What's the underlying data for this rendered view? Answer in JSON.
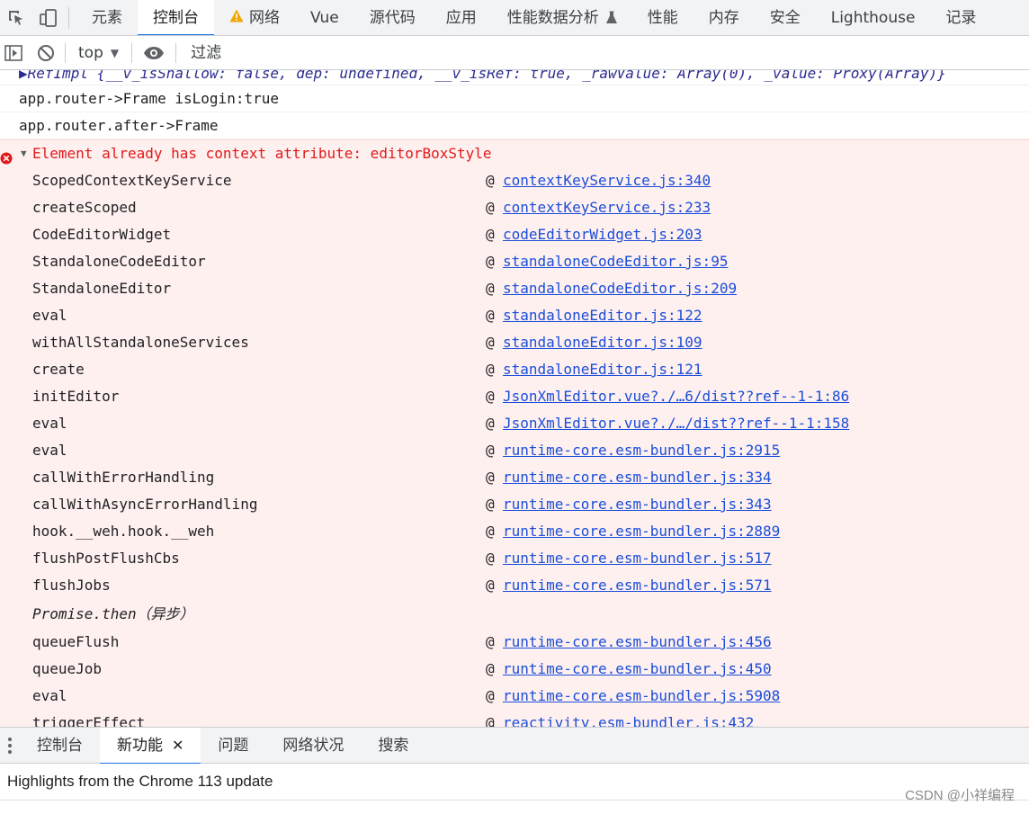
{
  "tabs": [
    {
      "label": "元素"
    },
    {
      "label": "控制台",
      "active": true
    },
    {
      "label": "网络",
      "warning": true
    },
    {
      "label": "Vue"
    },
    {
      "label": "源代码"
    },
    {
      "label": "应用"
    },
    {
      "label": "性能数据分析",
      "icon": "flask-icon"
    },
    {
      "label": "性能"
    },
    {
      "label": "内存"
    },
    {
      "label": "安全"
    },
    {
      "label": "Lighthouse"
    },
    {
      "label": "记录"
    }
  ],
  "toolbar": {
    "context": "top",
    "filter_placeholder": "过滤"
  },
  "console": {
    "cut_line": "▶RefImpl {__v_isShallow: false, dep: undefined, __v_isRef: true, _rawValue: Array(0), _value: Proxy(Array)}",
    "logs": [
      "app.router->Frame isLogin:true",
      "app.router.after->Frame"
    ],
    "error": {
      "message": "Element already has context attribute: editorBoxStyle",
      "at_symbol": "@",
      "frames": [
        {
          "fn": "ScopedContextKeyService",
          "src": "contextKeyService.js:340"
        },
        {
          "fn": "createScoped",
          "src": "contextKeyService.js:233"
        },
        {
          "fn": "CodeEditorWidget",
          "src": "codeEditorWidget.js:203"
        },
        {
          "fn": "StandaloneCodeEditor",
          "src": "standaloneCodeEditor.js:95"
        },
        {
          "fn": "StandaloneEditor",
          "src": "standaloneCodeEditor.js:209"
        },
        {
          "fn": "eval",
          "src": "standaloneEditor.js:122"
        },
        {
          "fn": "withAllStandaloneServices",
          "src": "standaloneEditor.js:109"
        },
        {
          "fn": "create",
          "src": "standaloneEditor.js:121"
        },
        {
          "fn": "initEditor",
          "src": "JsonXmlEditor.vue?./…6/dist??ref--1-1:86"
        },
        {
          "fn": "eval",
          "src": "JsonXmlEditor.vue?./…/dist??ref--1-1:158"
        },
        {
          "fn": "eval",
          "src": "runtime-core.esm-bundler.js:2915"
        },
        {
          "fn": "callWithErrorHandling",
          "src": "runtime-core.esm-bundler.js:334"
        },
        {
          "fn": "callWithAsyncErrorHandling",
          "src": "runtime-core.esm-bundler.js:343"
        },
        {
          "fn": "hook.__weh.hook.__weh",
          "src": "runtime-core.esm-bundler.js:2889"
        },
        {
          "fn": "flushPostFlushCbs",
          "src": "runtime-core.esm-bundler.js:517"
        },
        {
          "fn": "flushJobs",
          "src": "runtime-core.esm-bundler.js:571"
        },
        {
          "fn": "Promise.then（异步）",
          "src": null,
          "async": true
        },
        {
          "fn": "queueFlush",
          "src": "runtime-core.esm-bundler.js:456"
        },
        {
          "fn": "queueJob",
          "src": "runtime-core.esm-bundler.js:450"
        },
        {
          "fn": "eval",
          "src": "runtime-core.esm-bundler.js:5908"
        },
        {
          "fn": "triggerEffect",
          "src": "reactivity.esm-bundler.js:432"
        }
      ]
    }
  },
  "drawer": {
    "tabs": [
      {
        "label": "控制台"
      },
      {
        "label": "新功能",
        "active": true,
        "closable": true,
        "close_glyph": "✕"
      },
      {
        "label": "问题"
      },
      {
        "label": "网络状况"
      },
      {
        "label": "搜索"
      }
    ],
    "content": "Highlights from the Chrome 113 update"
  },
  "watermark": "CSDN @小祥编程",
  "colors": {
    "accent": "#1a73e8",
    "error_text": "#e01a1a",
    "error_bg": "#fff0f0",
    "link": "#1a4ed8"
  }
}
